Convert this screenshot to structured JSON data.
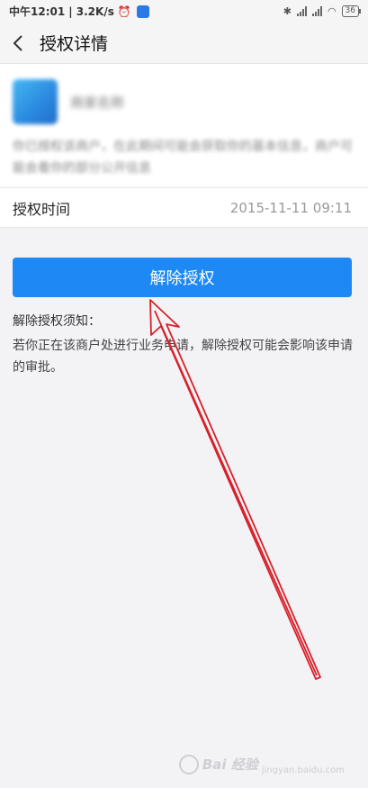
{
  "status_bar": {
    "time": "中午12:01",
    "speed": "| 3.2K/s",
    "alarm_icon": "alarm-clock-icon",
    "app_icon": "app-notification-icon",
    "battery": "36"
  },
  "nav": {
    "back_icon": "chevron-left-icon",
    "title": "授权详情"
  },
  "app_card": {
    "name": "商家名称",
    "description": "你已授权该商户，在此期间可能会获取你的基本信息，商户可能会看你的部分公开信息"
  },
  "auth_time": {
    "label": "授权时间",
    "value": "2015-11-11 09:11"
  },
  "revoke_button": {
    "label": "解除授权",
    "color": "#1e88f5"
  },
  "notice": {
    "title": "解除授权须知：",
    "text": "若你正在该商户处进行业务申请，解除授权可能会影响该申请的审批。"
  },
  "annotation": {
    "color": "#d8202a"
  },
  "watermark": {
    "text": "Bai 经验",
    "sub": "jingyan.baidu.com"
  }
}
